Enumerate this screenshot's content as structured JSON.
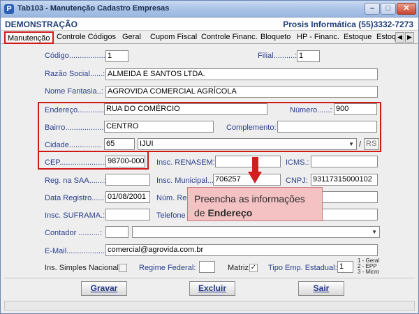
{
  "window": {
    "title": "Tab103 - Manutenção Cadastro Empresas",
    "company": "DEMONSTRAÇÃO",
    "vendor": "Prosis Informática (55)3332-7273"
  },
  "tabs": [
    {
      "label": "Manutenção",
      "active": true
    },
    {
      "label": "Controle Códigos"
    },
    {
      "label": "Geral"
    },
    {
      "label": "Cupom Fiscal"
    },
    {
      "label": "Controle Financ."
    },
    {
      "label": "Bloqueto"
    },
    {
      "label": "HP - Financ."
    },
    {
      "label": "Estoque"
    },
    {
      "label": "Estoq"
    }
  ],
  "form": {
    "codigo": {
      "label": "Código.................:",
      "value": "1"
    },
    "filial": {
      "label": "Filial..........:",
      "value": "1"
    },
    "razao_social": {
      "label": "Razão Social......:",
      "value": "ALMEIDA E SANTOS LTDA."
    },
    "nome_fantasia": {
      "label": "Nome Fantasia..:",
      "value": "AGROVIDA COMERCIAL AGRÍCOLA"
    },
    "endereco": {
      "label": "Endereço...............",
      "value": "RUA DO COMÉRCIO"
    },
    "numero": {
      "label": "Número......:",
      "value": "900"
    },
    "bairro": {
      "label": "Bairro.....................",
      "value": "CENTRO"
    },
    "complemento": {
      "label": "Complemento:",
      "value": ""
    },
    "cidade": {
      "label": "Cidade...............",
      "code": "65",
      "name": "IJUI",
      "uf": "RS"
    },
    "cep": {
      "label": "CEP......................",
      "value": "98700-000"
    },
    "insc_renasem": {
      "label": "Insc. RENASEM:",
      "value": ""
    },
    "icms": {
      "label": "ICMS.:",
      "value": ""
    },
    "reg_saa": {
      "label": "Reg. na SAA.......:",
      "value": ""
    },
    "insc_municipal": {
      "label": "Insc. Municipal...:",
      "value": "706257"
    },
    "cnpj": {
      "label": "CNPJ:",
      "value": "93117315000102"
    },
    "data_registro": {
      "label": "Data Registro......:",
      "value": "01/08/2001"
    },
    "num_reg": {
      "label": "Núm. Reg",
      "value": ""
    },
    "insc_suframa": {
      "label": "Insc. SUFRAMA.:",
      "value": ""
    },
    "telefone": {
      "label": "Telefone",
      "value": ""
    },
    "contador": {
      "label": "Contador ..........:",
      "code": "",
      "name": ""
    },
    "email": {
      "label": "E-Mail...................:",
      "value": "comercial@agrovida.com.br"
    },
    "simples": {
      "label": "Ins. Simples Nacional",
      "checked": false
    },
    "regime_federal": {
      "label": "Regime Federal:",
      "value": ""
    },
    "matriz": {
      "label": "Matriz",
      "checked": true
    },
    "tipo_emp_estadual": {
      "label": "Tipo Emp. Estadual:",
      "value": "1",
      "options": [
        "1 - Geral",
        "2 - EPP",
        "3 - Micro"
      ]
    }
  },
  "buttons": {
    "gravar": "Gravar",
    "excluir": "Excluir",
    "sair": "Sair"
  },
  "callout": {
    "line1": "Preencha as informações",
    "line2_prefix": "de ",
    "line2_bold": "Endereço"
  },
  "colors": {
    "highlight": "#d01a1a",
    "callout_bg": "#f4c2c2",
    "label_blue": "#2b3f8f"
  }
}
